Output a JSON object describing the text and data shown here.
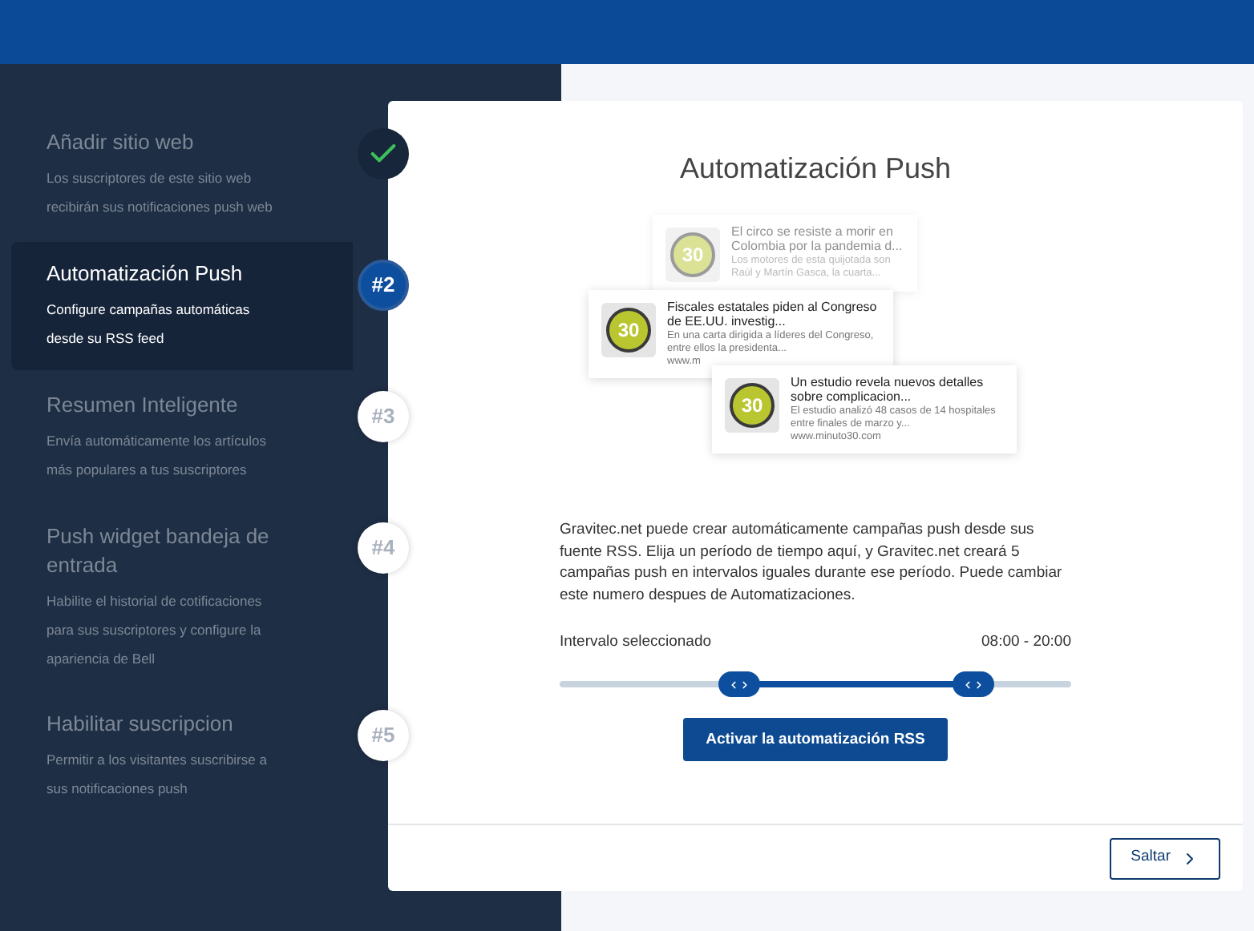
{
  "steps": [
    {
      "title": "Añadir sitio web",
      "description": "Los suscriptores de este sitio web recibirán sus notificaciones push web",
      "completed": true,
      "selected": false
    },
    {
      "title": "Automatización Push",
      "description": "Configure campañas automáticas desde su RSS feed",
      "completed": false,
      "selected": true,
      "badge": "#2"
    },
    {
      "title": "Resumen Inteligente",
      "description": "Envía automáticamente los artículos más populares a tus suscriptores",
      "completed": false,
      "selected": false,
      "badge": "#3"
    },
    {
      "title": "Push widget bandeja de entrada",
      "description": "Habilite el historial de cotificaciones para sus suscriptores y configure la apariencia de Bell",
      "completed": false,
      "selected": false,
      "badge": "#4"
    },
    {
      "title": "Habilitar suscripcion",
      "description": "Permitir a los visitantes suscribirse a sus notificaciones push",
      "completed": false,
      "selected": false,
      "badge": "#5"
    }
  ],
  "card": {
    "title": "Automatización Push",
    "notifications": [
      {
        "logo_text": "30",
        "title": "El circo se resiste a morir en Colombia por la pandemia d...",
        "body": "Los motores de esta quijotada son Raúl y Martín Gasca, la cuarta...",
        "faded": true
      },
      {
        "logo_text": "30",
        "title": "Fiscales estatales piden al Congreso de EE.UU. investig...",
        "body": "En una carta dirigida a líderes del Congreso, entre ellos la presidenta...",
        "url": "www.m",
        "faded": false
      },
      {
        "logo_text": "30",
        "title": "Un estudio revela nuevos detalles sobre complicacion...",
        "body": "El estudio analizó 48 casos de 14 hospitales entre finales de marzo y...",
        "url": "www.minuto30.com",
        "faded": false
      }
    ],
    "description": "Gravitec.net puede crear automáticamente campañas push desde sus fuente RSS. Elija un período de tiempo aquí, y Gravitec.net creará 5 campañas push en intervalos iguales durante ese período. Puede cambiar este numero despues de Automatizaciones.",
    "interval_label": "Intervalo seleccionado",
    "interval_value": "08:00 - 20:00",
    "slider": {
      "thumbs": [
        {
          "level": 0.35
        },
        {
          "level": 0.81
        }
      ]
    },
    "activate_button": "Activar la automatización RSS",
    "skip_button": "Saltar"
  }
}
